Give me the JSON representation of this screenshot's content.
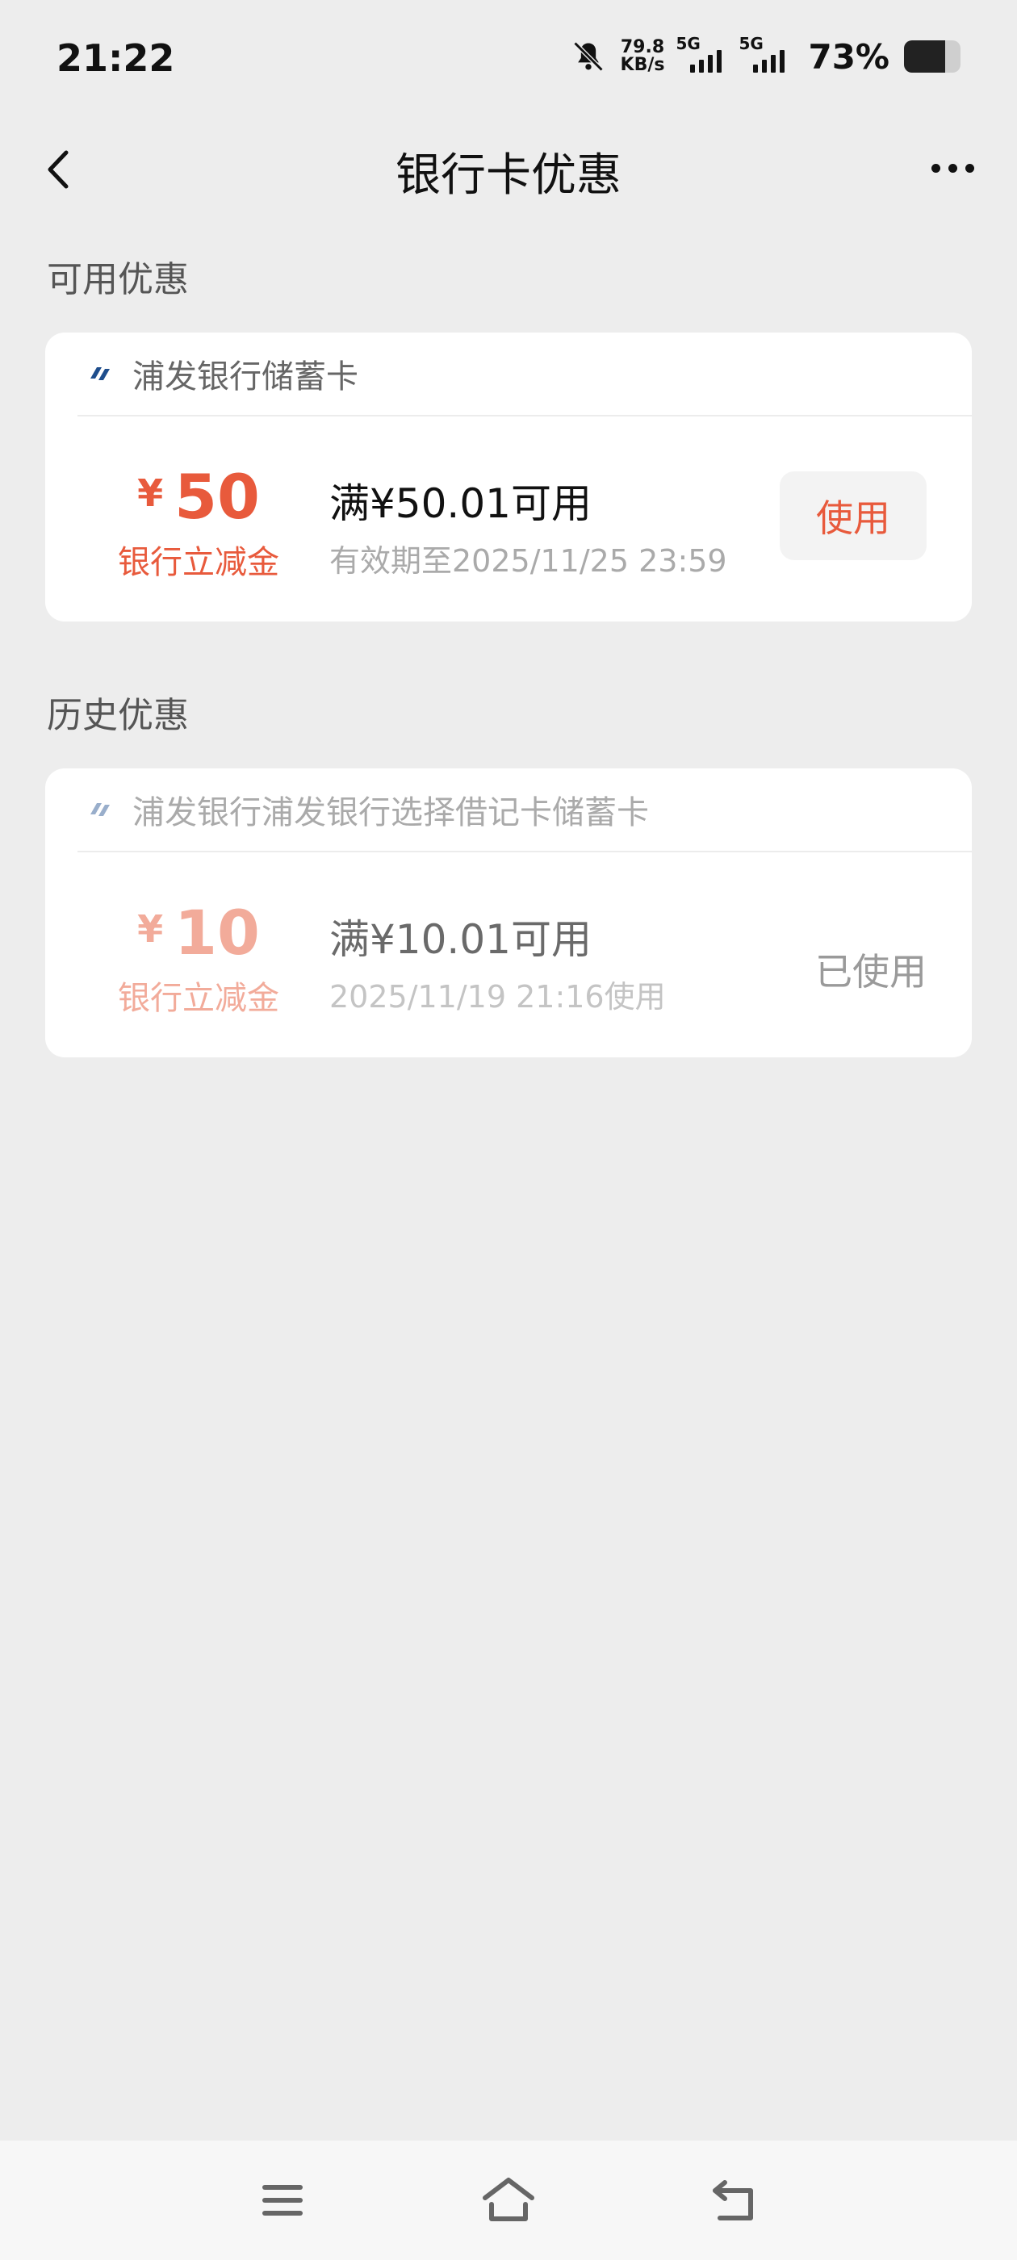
{
  "status_bar": {
    "time": "21:22",
    "net_speed_value": "79.8",
    "net_speed_unit": "KB/s",
    "sim1": "5G",
    "sim2": "5G",
    "battery_percent": "73%",
    "battery_level": 0.73,
    "icons": [
      "bell-muted-icon",
      "signal-icon",
      "battery-icon"
    ]
  },
  "header": {
    "title": "银行卡优惠",
    "back_icon": "chevron-left-icon",
    "more_icon": "more-dots-icon"
  },
  "available": {
    "section_title": "可用优惠",
    "card": {
      "bank": "浦发银行储蓄卡",
      "currency": "¥",
      "amount": "50",
      "amount_label": "银行立减金",
      "condition": "满¥50.01可用",
      "validity": "有效期至2025/11/25 23:59",
      "action_label": "使用"
    }
  },
  "history": {
    "section_title": "历史优惠",
    "card": {
      "bank": "浦发银行浦发银行选择借记卡储蓄卡",
      "currency": "¥",
      "amount": "10",
      "amount_label": "银行立减金",
      "condition": "满¥10.01可用",
      "used_time": "2025/11/19 21:16使用",
      "status": "已使用"
    }
  },
  "colors": {
    "accent": "#e85a3c",
    "background": "#ededed",
    "bank_logo": "#1e4d8c"
  },
  "system_nav": {
    "icons": [
      "menu-icon",
      "home-icon",
      "back-return-icon"
    ]
  }
}
